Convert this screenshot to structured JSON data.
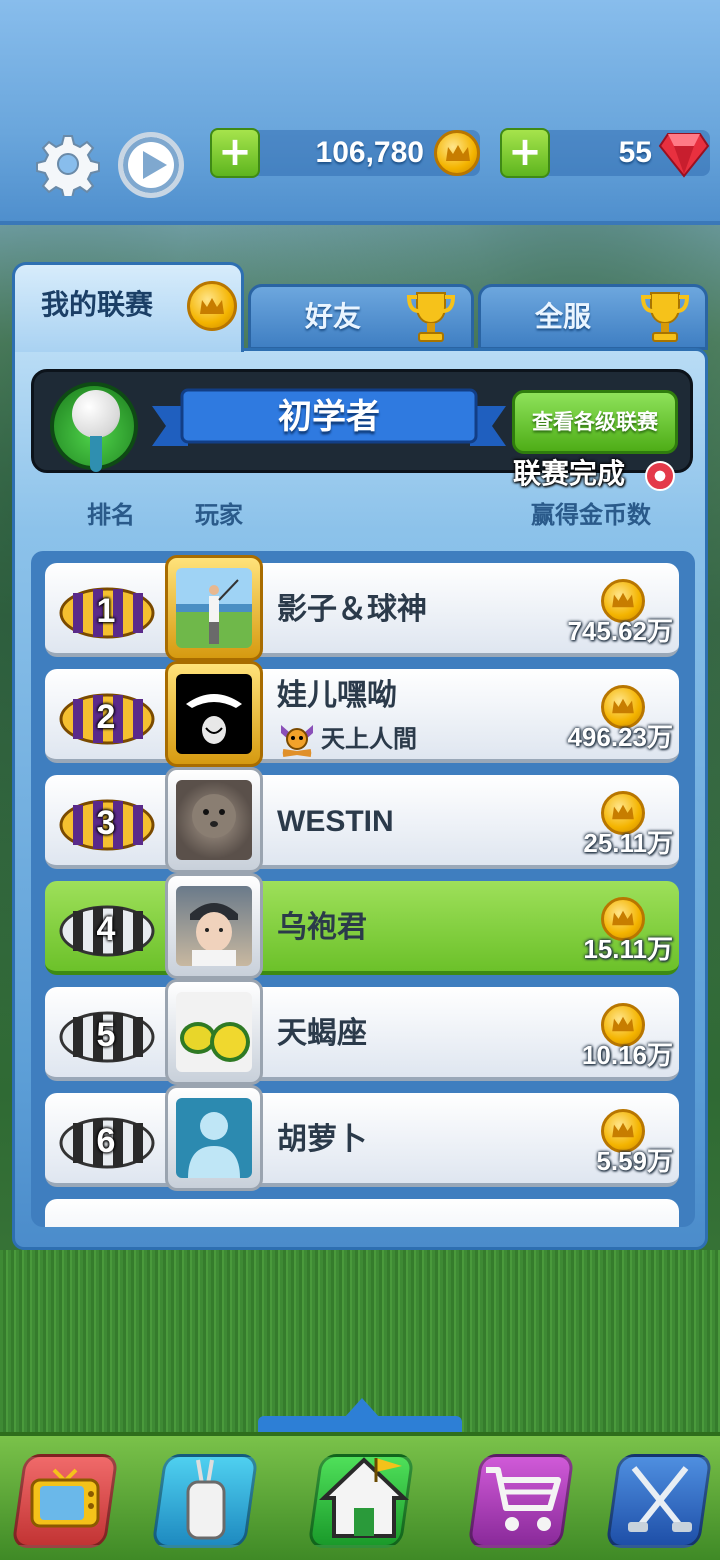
{
  "currency": {
    "coins": "106,780",
    "gems": "55"
  },
  "tabs": [
    {
      "label": "我的联赛",
      "active": true
    },
    {
      "label": "好友",
      "active": false
    },
    {
      "label": "全服",
      "active": false
    }
  ],
  "league": {
    "tier_name": "初学者",
    "view_button": "查看各级联赛",
    "status": "联赛完成"
  },
  "columns": {
    "rank": "排名",
    "player": "玩家",
    "coins": "赢得金币数"
  },
  "leaderboard": [
    {
      "rank": "1",
      "name": "影子＆球神",
      "club": "",
      "reward": "745.62万",
      "chest": "gold",
      "frame": "gold",
      "highlight": false
    },
    {
      "rank": "2",
      "name": "娃儿嘿呦",
      "club": "天上人間",
      "reward": "496.23万",
      "chest": "gold",
      "frame": "gold",
      "highlight": false
    },
    {
      "rank": "3",
      "name": "WESTIN",
      "club": "",
      "reward": "25.11万",
      "chest": "gold",
      "frame": "silver",
      "highlight": false
    },
    {
      "rank": "4",
      "name": "乌袍君",
      "club": "",
      "reward": "15.11万",
      "chest": "silver",
      "frame": "silver",
      "highlight": true
    },
    {
      "rank": "5",
      "name": "天蝎座",
      "club": "",
      "reward": "10.16万",
      "chest": "silver",
      "frame": "silver",
      "highlight": false
    },
    {
      "rank": "6",
      "name": "胡萝卜",
      "club": "",
      "reward": "5.59万",
      "chest": "silver",
      "frame": "silver",
      "highlight": false
    }
  ],
  "nav": [
    {
      "icon": "tv-icon"
    },
    {
      "icon": "golf-bag-icon"
    },
    {
      "icon": "home-icon",
      "active": true
    },
    {
      "icon": "shop-cart-icon"
    },
    {
      "icon": "crossed-clubs-icon"
    }
  ],
  "colors": {
    "accent_green": "#6cc12a",
    "panel_blue": "#5d9fd7",
    "gold": "#f4b400"
  }
}
